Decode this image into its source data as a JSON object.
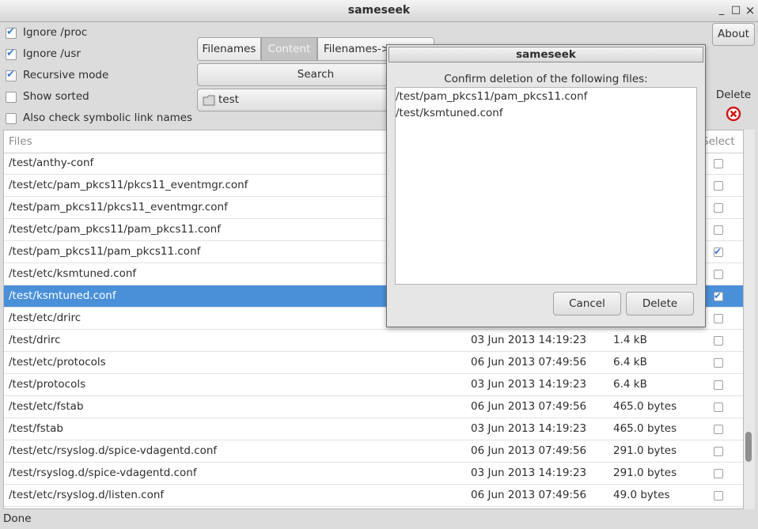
{
  "window": {
    "title": "sameseek",
    "minimize": "_",
    "maximize": "□",
    "close": "×"
  },
  "options": [
    {
      "label": "Ignore /proc",
      "checked": true
    },
    {
      "label": "Ignore /usr",
      "checked": true
    },
    {
      "label": "Recursive mode",
      "checked": true
    },
    {
      "label": "Show sorted",
      "checked": false
    },
    {
      "label": "Also check symbolic link names",
      "checked": false
    }
  ],
  "tabs": [
    {
      "label": "Filenames",
      "active": false
    },
    {
      "label": "Content",
      "active": true
    },
    {
      "label": "Filenames->",
      "active": false
    }
  ],
  "search_button": "Search",
  "folder": {
    "icon": "folder-icon",
    "name": "test"
  },
  "about_button": "About",
  "delete": {
    "label": "Delete",
    "icon": "delete-circle-icon"
  },
  "table": {
    "headers": {
      "files": "Files",
      "select": "Select"
    },
    "rows": [
      {
        "file": "/test/anthy-conf",
        "date": "",
        "size": "",
        "checked": false,
        "selected": false
      },
      {
        "file": "/test/etc/pam_pkcs11/pkcs11_eventmgr.conf",
        "date": "",
        "size": "",
        "checked": false,
        "selected": false
      },
      {
        "file": "/test/pam_pkcs11/pkcs11_eventmgr.conf",
        "date": "",
        "size": "",
        "checked": false,
        "selected": false
      },
      {
        "file": "/test/etc/pam_pkcs11/pam_pkcs11.conf",
        "date": "",
        "size": "",
        "checked": false,
        "selected": false
      },
      {
        "file": "/test/pam_pkcs11/pam_pkcs11.conf",
        "date": "",
        "size": "",
        "checked": true,
        "selected": false
      },
      {
        "file": "/test/etc/ksmtuned.conf",
        "date": "",
        "size": "",
        "checked": false,
        "selected": false
      },
      {
        "file": "/test/ksmtuned.conf",
        "date": "",
        "size": "",
        "checked": true,
        "selected": true
      },
      {
        "file": "/test/etc/drirc",
        "date": "",
        "size": "",
        "checked": false,
        "selected": false
      },
      {
        "file": "/test/drirc",
        "date": "03 Jun 2013 14:19:23",
        "size": "1.4 kB",
        "checked": false,
        "selected": false
      },
      {
        "file": "/test/etc/protocols",
        "date": "06 Jun 2013 07:49:56",
        "size": "6.4 kB",
        "checked": false,
        "selected": false
      },
      {
        "file": "/test/protocols",
        "date": "03 Jun 2013 14:19:23",
        "size": "6.4 kB",
        "checked": false,
        "selected": false
      },
      {
        "file": "/test/etc/fstab",
        "date": "06 Jun 2013 07:49:56",
        "size": "465.0 bytes",
        "checked": false,
        "selected": false
      },
      {
        "file": "/test/fstab",
        "date": "03 Jun 2013 14:19:23",
        "size": "465.0 bytes",
        "checked": false,
        "selected": false
      },
      {
        "file": "/test/etc/rsyslog.d/spice-vdagentd.conf",
        "date": "06 Jun 2013 07:49:56",
        "size": "291.0 bytes",
        "checked": false,
        "selected": false
      },
      {
        "file": "/test/rsyslog.d/spice-vdagentd.conf",
        "date": "03 Jun 2013 14:19:23",
        "size": "291.0 bytes",
        "checked": false,
        "selected": false
      },
      {
        "file": "/test/etc/rsyslog.d/listen.conf",
        "date": "06 Jun 2013 07:49:56",
        "size": "49.0 bytes",
        "checked": false,
        "selected": false
      }
    ]
  },
  "status": "Done",
  "dialog": {
    "title": "sameseek",
    "message": "Confirm deletion of the following files:",
    "files": [
      "/test/pam_pkcs11/pam_pkcs11.conf",
      "/test/ksmtuned.conf"
    ],
    "cancel_button": "Cancel",
    "delete_button": "Delete"
  },
  "colors": {
    "selection": "#4a90d9",
    "check": "#3b7fd0",
    "delete_icon": "#d11a1a"
  }
}
